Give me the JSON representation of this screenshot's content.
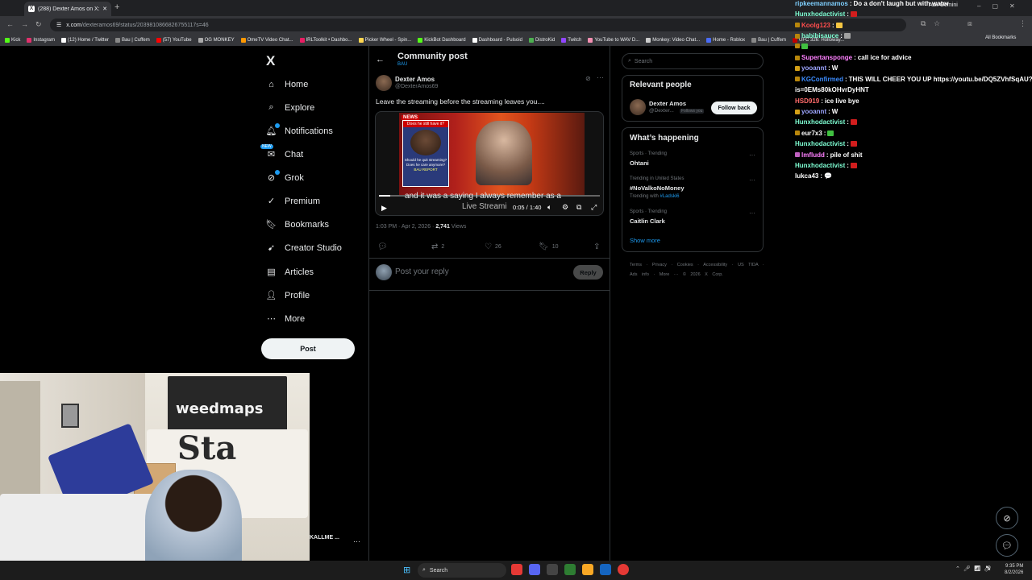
{
  "browser": {
    "tab_title": "(288) Dexter Amos on X: \"Leave...",
    "tab_favicon": "X",
    "new_tab_symbol": "+",
    "url_host": "x.com",
    "url_path": "/dexteramos69/status/2039810866826755117s=46",
    "ask_gemini": "Ask Gemini",
    "all_bookmarks": "All Bookmarks",
    "bookmarks": [
      {
        "label": "Kick",
        "color": "#53fc18"
      },
      {
        "label": "Instagram",
        "color": "#e1306c"
      },
      {
        "label": "(12) Home / Twitter",
        "color": "#ffffff"
      },
      {
        "label": "Bau | Cuffem",
        "color": "#888888"
      },
      {
        "label": "(57) YouTube",
        "color": "#ff0000"
      },
      {
        "label": "OG MONKEY",
        "color": "#aaaaaa"
      },
      {
        "label": "OmeTV Video Chat...",
        "color": "#ff9800"
      },
      {
        "label": "IRLToolkit • Dashbo...",
        "color": "#e91e63"
      },
      {
        "label": "Picker Wheel - Spin...",
        "color": "#ffd54f"
      },
      {
        "label": "KickBot Dashboard",
        "color": "#53fc18"
      },
      {
        "label": "Dashboard - Pulsoid",
        "color": "#ffffff"
      },
      {
        "label": "DistroKid",
        "color": "#4caf50"
      },
      {
        "label": "Twitch",
        "color": "#9146ff"
      },
      {
        "label": "YouTube to WAV D...",
        "color": "#f48fb1"
      },
      {
        "label": "Monkey: Video Chat...",
        "color": "#cccccc"
      },
      {
        "label": "Home - Roblox",
        "color": "#4a6cf7"
      },
      {
        "label": "Bau | Cuffem",
        "color": "#888888"
      },
      {
        "label": "UFC 326: Holloway...",
        "color": "#c00000"
      }
    ]
  },
  "sidebar": {
    "logo": "X",
    "items": [
      {
        "label": "Home",
        "icon": "home-icon",
        "glyph": "⌂"
      },
      {
        "label": "Explore",
        "icon": "search-icon",
        "glyph": "⌕"
      },
      {
        "label": "Notifications",
        "icon": "bell-icon",
        "glyph": "🔔︎"
      },
      {
        "label": "Chat",
        "icon": "chat-icon",
        "glyph": "✉"
      },
      {
        "label": "Grok",
        "icon": "grok-icon",
        "glyph": "⊘"
      },
      {
        "label": "Premium",
        "icon": "premium-icon",
        "glyph": "✓"
      },
      {
        "label": "Bookmarks",
        "icon": "bookmark-icon",
        "glyph": "🔖︎"
      },
      {
        "label": "Creator Studio",
        "icon": "rocket-icon",
        "glyph": "➹"
      },
      {
        "label": "Articles",
        "icon": "article-icon",
        "glyph": "▤"
      },
      {
        "label": "Profile",
        "icon": "profile-icon",
        "glyph": "👤︎"
      },
      {
        "label": "More",
        "icon": "more-icon",
        "glyph": "⋯"
      }
    ],
    "chat_badge": "NEW",
    "post_label": "Post",
    "account_name": "KALLME ...",
    "account_more": "···"
  },
  "post": {
    "header_title": "Community post",
    "header_sub": "BAU",
    "author_name": "Dexter Amos",
    "author_handle": "@DexterAmos69",
    "text": "Leave the streaming before the streaming leaves you....",
    "video": {
      "news_tag": "NEWS",
      "headline": "Does he still have it?",
      "question": "Should he quit streaming? Does he care anymore?",
      "report": "BAU REPORT",
      "caption": "and it was a saying I always remember as a",
      "caption2": "Live Streami",
      "time": "0:05 / 1:40",
      "progress": 0.05
    },
    "time": "1:03 PM · Apr 2, 2026 · ",
    "views_count": "2,741",
    "views_label": " Views",
    "reposts": "2",
    "likes": "26",
    "bookmarks": "10",
    "reply_placeholder": "Post your reply",
    "reply_label": "Reply"
  },
  "right": {
    "search_placeholder": "Search",
    "relevant_title": "Relevant people",
    "rel_name": "Dexter Amos",
    "rel_handle": "@Dexter...",
    "rel_follows_you": "Follows you",
    "follow_back": "Follow back",
    "happening_title": "What’s happening",
    "trends": [
      {
        "meta": "Sports · Trending",
        "name": "Ohtani"
      },
      {
        "meta": "Trending in United States",
        "name": "#NoValkoNoMoney"
      },
      {
        "meta": "Sports · Trending",
        "name": "Caitlin Clark"
      }
    ],
    "trend_with_prefix": "Trending with ",
    "trend_with_tag": "#Ladski6",
    "show_more": "Show more",
    "footer": "Terms · Privacy · Cookies · Accessibility · US TIDA · Ads info · More ··· © 2026 X Corp."
  },
  "chat": [
    {
      "user": "ripkeemannamos",
      "color": "#7fd0ff",
      "msg": "Do a don't laugh but with water",
      "badge": ""
    },
    {
      "user": "Hunxhodactivist",
      "color": "#7fffd4",
      "msg": "",
      "badge": "",
      "emote": "#d21d1d"
    },
    {
      "user": "Koolg123",
      "color": "#ff4d4d",
      "msg": "",
      "badge": "#b8860b",
      "emote": "#f4c542"
    },
    {
      "user": "habibisauce",
      "color": "#7fffd4",
      "msg": "",
      "badge": "#b8860b",
      "emote": "#a0a0a0"
    },
    {
      "user": "",
      "color": "#7fffd4",
      "msg": "",
      "badge": "#b8860b",
      "emote": "#40c040"
    },
    {
      "user": "Supertansponge",
      "color": "#ff80ff",
      "msg": "call ice for advice",
      "badge": "#b8860b"
    },
    {
      "user": "yooannt",
      "color": "#9da5ff",
      "msg": "W",
      "badge": "#d4a017"
    },
    {
      "user": "KGConfirmed",
      "color": "#3c8cff",
      "msg": "THIS WILL CHEER YOU UP https://youtu.be/DQ5ZVhfSqAU?",
      "badge": "#b8860b"
    },
    {
      "user": "",
      "color": "#fff",
      "msg": "is=0EMs80kOHvrDyHNT",
      "badge": ""
    },
    {
      "user": "HSD919",
      "color": "#ff6b6b",
      "msg": "ice live bye",
      "badge": ""
    },
    {
      "user": "yooannt",
      "color": "#9da5ff",
      "msg": "W",
      "badge": "#d4a017"
    },
    {
      "user": "Hunxhodactivist",
      "color": "#7fffd4",
      "msg": "",
      "badge": "",
      "emote": "#d21d1d"
    },
    {
      "user": "eur7x3",
      "color": "#fff",
      "msg": "",
      "badge": "#b8860b",
      "emote": "#40c040"
    },
    {
      "user": "Hunxhodactivist",
      "color": "#7fffd4",
      "msg": "",
      "badge": "",
      "emote": "#d21d1d"
    },
    {
      "user": "Imfludd",
      "color": "#ff80ff",
      "msg": "pile of shit",
      "badge": "#c060c0"
    },
    {
      "user": "Hunxhodactivist",
      "color": "#7fffd4",
      "msg": "",
      "badge": "",
      "emote": "#d21d1d"
    },
    {
      "user": "lukca43",
      "color": "#fff",
      "msg": "💬",
      "badge": ""
    }
  ],
  "webcam": {
    "banner": "weedmaps",
    "wall_text": "Sta"
  },
  "taskbar": {
    "search": "Search",
    "time": "9:35 PM",
    "date": "8/2/2026"
  },
  "colors": {
    "accent": "#1d9bf0",
    "border": "#2f3336",
    "muted": "#71767b"
  }
}
